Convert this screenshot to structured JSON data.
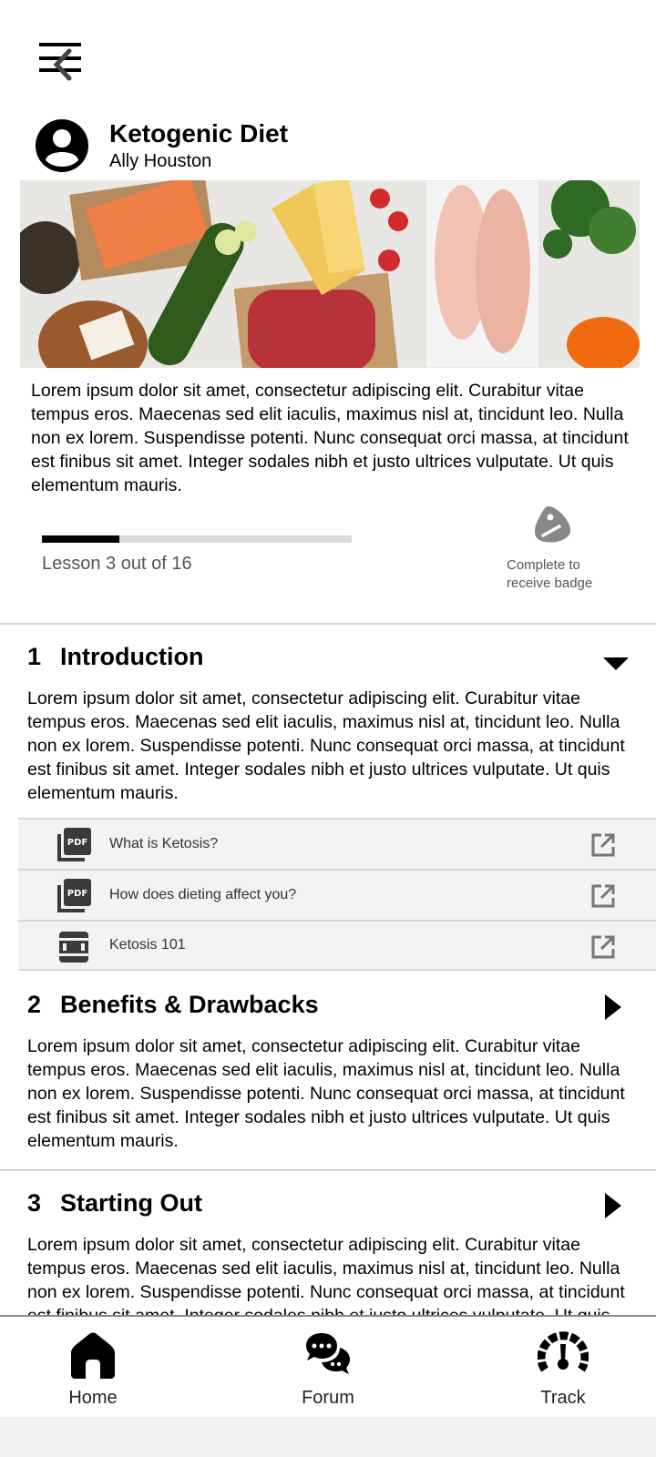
{
  "course": {
    "title": "Ketogenic Diet",
    "author": "Ally Houston",
    "description": "Lorem ipsum dolor sit amet, consectetur adipiscing elit. Curabitur vitae tempus eros. Maecenas sed elit iaculis, maximus nisl at, tincidunt leo. Nulla non ex lorem. Suspendisse potenti. Nunc consequat orci massa, at tincidunt est finibus sit amet. Integer sodales nibh et justo ultrices vulputate. Ut quis elementum mauris."
  },
  "progress": {
    "label": "Lesson 3 out of 16",
    "fraction": 0.25
  },
  "badge": {
    "text": "Complete to receive badge"
  },
  "sections": [
    {
      "number": "1",
      "title": "Introduction",
      "state": "expanded",
      "body": "Lorem ipsum dolor sit amet, consectetur adipiscing elit. Curabitur vitae tempus eros. Maecenas sed elit iaculis, maximus nisl at, tincidunt leo. Nulla non ex lorem. Suspendisse potenti. Nunc consequat orci massa, at tincidunt est finibus sit amet. Integer sodales nibh et justo ultrices vulputate. Ut quis elementum mauris.",
      "resources": [
        {
          "label": "What is Ketosis?",
          "icon": "pdf-icon"
        },
        {
          "label": "How does dieting affect you?",
          "icon": "pdf-icon"
        },
        {
          "label": "Ketosis 101",
          "icon": "video-film-icon"
        }
      ]
    },
    {
      "number": "2",
      "title": "Benefits & Drawbacks",
      "state": "collapsed",
      "body": "Lorem ipsum dolor sit amet, consectetur adipiscing elit. Curabitur vitae tempus eros. Maecenas sed elit iaculis, maximus nisl at, tincidunt leo. Nulla non ex lorem. Suspendisse potenti. Nunc consequat orci massa, at tincidunt est finibus sit amet. Integer sodales nibh et justo ultrices vulputate. Ut quis elementum mauris."
    },
    {
      "number": "3",
      "title": "Starting Out",
      "state": "collapsed",
      "body": "Lorem ipsum dolor sit amet, consectetur adipiscing elit. Curabitur vitae tempus eros. Maecenas sed elit iaculis, maximus nisl at, tincidunt leo. Nulla non ex lorem. Suspendisse potenti. Nunc consequat orci massa, at tincidunt est finibus sit amet. Integer sodales nibh et justo ultrices vulputate. Ut quis elementum mauris."
    }
  ],
  "nav": {
    "items": [
      {
        "label": "Home",
        "icon": "home-icon"
      },
      {
        "label": "Forum",
        "icon": "chat-bubbles-icon"
      },
      {
        "label": "Track",
        "icon": "speedometer-icon"
      }
    ]
  },
  "icons": {
    "menu": "menu-back-icon",
    "avatar": "user-circle-icon",
    "badge": "badge-icon",
    "external": "external-link-icon"
  }
}
